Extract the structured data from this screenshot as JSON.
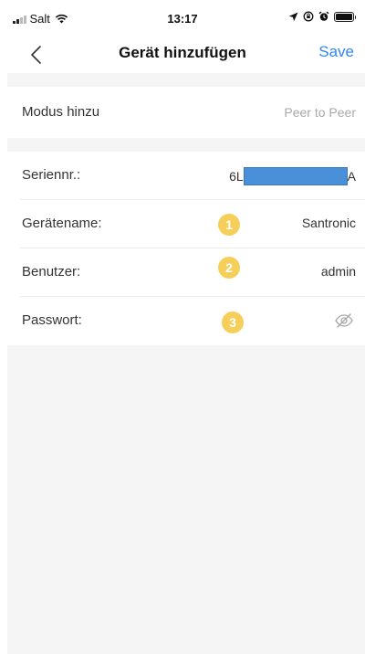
{
  "status_bar": {
    "carrier": "Salt",
    "time": "13:17"
  },
  "nav": {
    "title": "Gerät hinzufügen",
    "save_label": "Save"
  },
  "mode_row": {
    "label": "Modus hinzu",
    "value": "Peer to Peer"
  },
  "device_rows": {
    "serial": {
      "label": "Seriennr.:",
      "value_prefix": "6L",
      "value_suffix": "A"
    },
    "name": {
      "label": "Gerätename:",
      "value": "Santronic",
      "badge": "1"
    },
    "user": {
      "label": "Benutzer:",
      "value": "admin",
      "badge": "2"
    },
    "password": {
      "label": "Passwort:",
      "badge": "3"
    }
  },
  "colors": {
    "accent": "#2f86f6",
    "badge": "#f6cf5a",
    "redaction": "#4a90d9",
    "background": "#f5f5f5"
  }
}
